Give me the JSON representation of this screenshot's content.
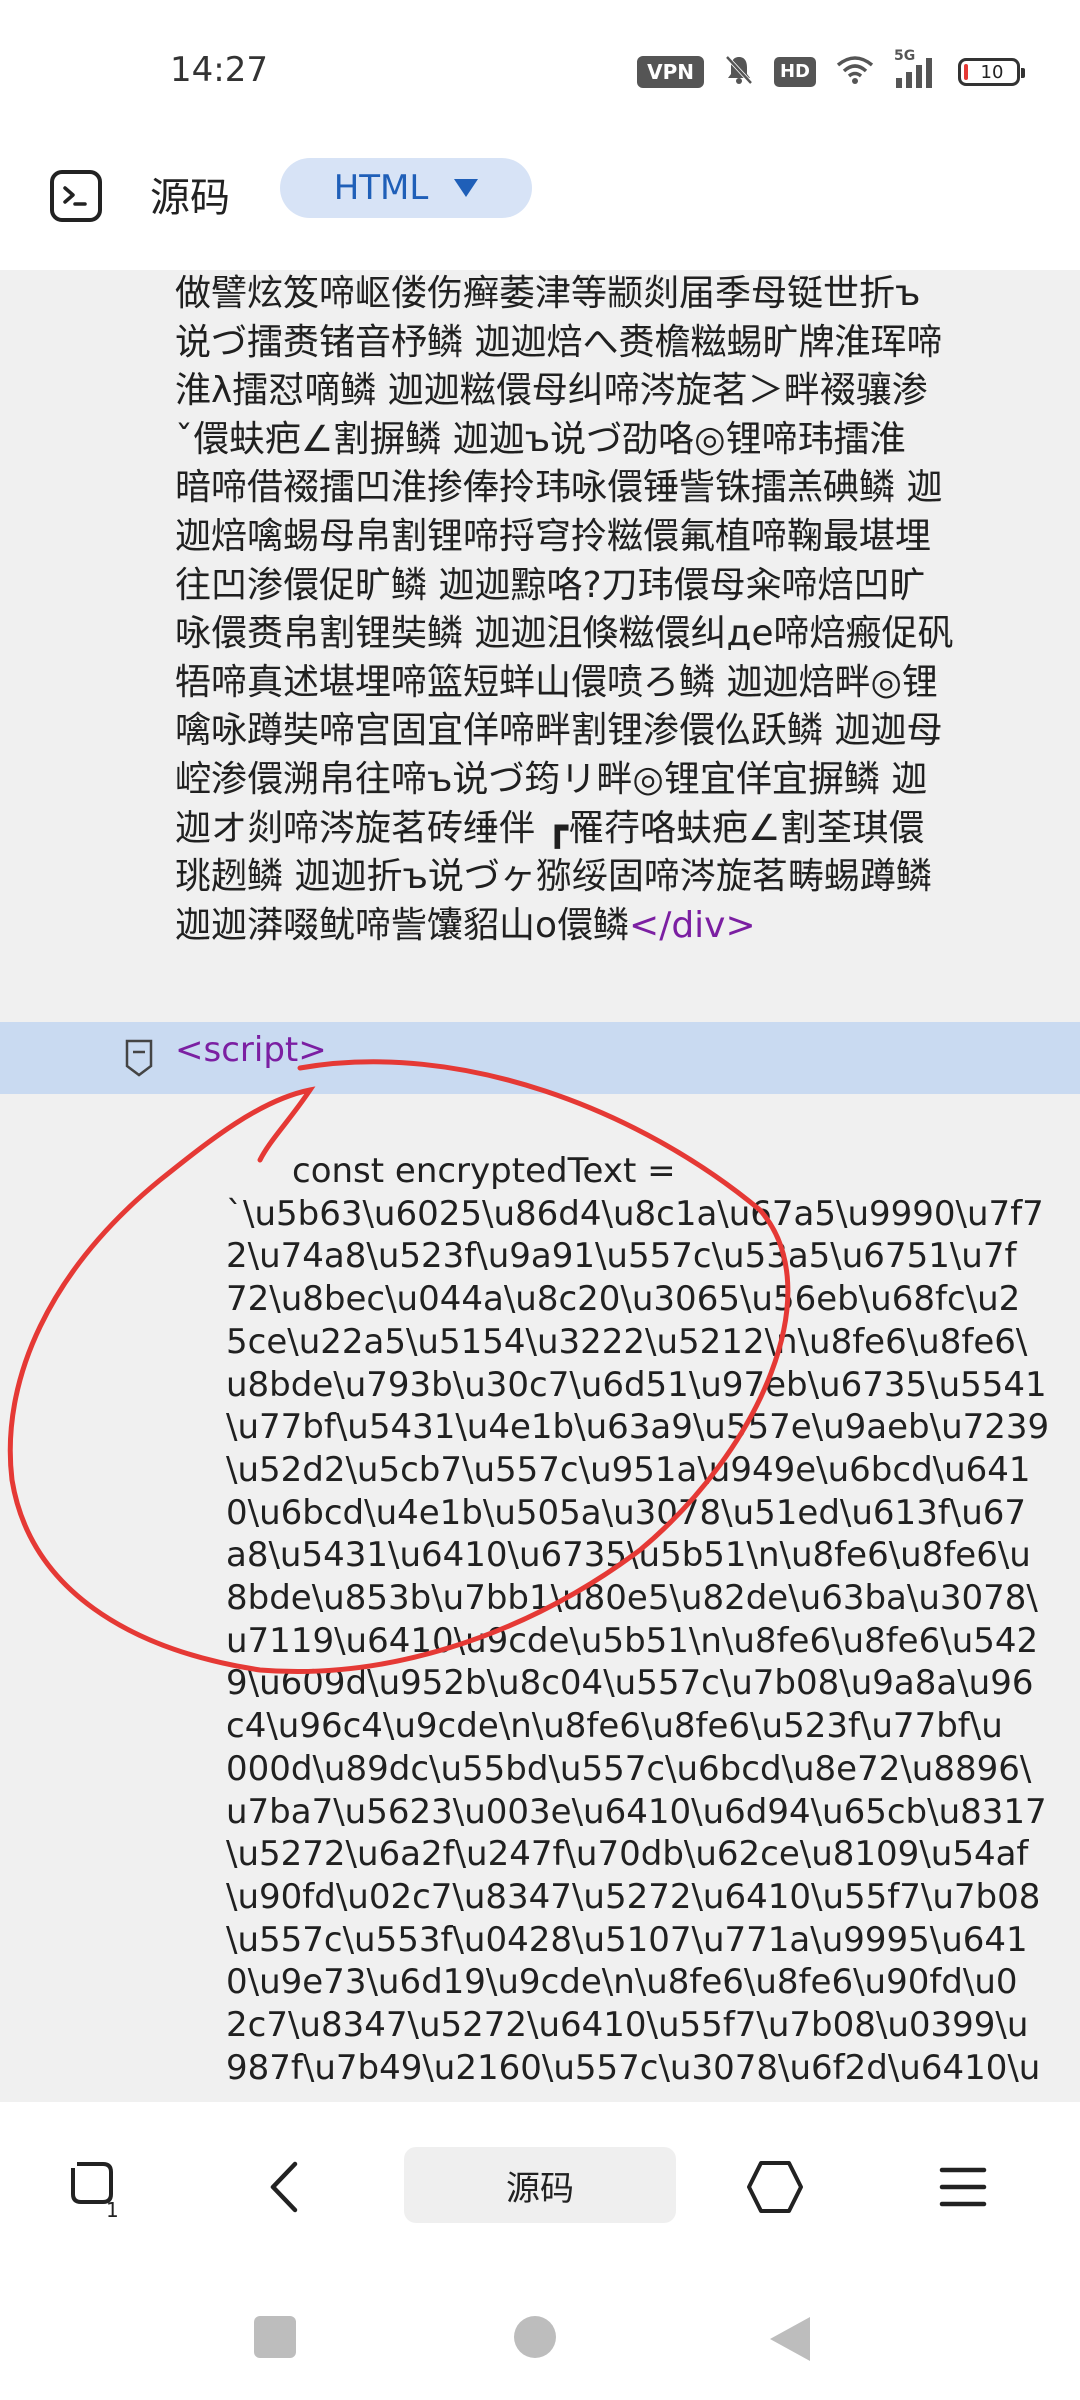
{
  "status_bar": {
    "time": "14:27",
    "vpn_badge": "VPN",
    "hd_badge": "HD",
    "network": "5G",
    "battery": "10",
    "icons": [
      "vpn-icon",
      "bell-muted-icon",
      "hd-icon",
      "wifi-icon",
      "signal-icon",
      "battery-icon"
    ]
  },
  "header": {
    "title": "源码",
    "language": "HTML"
  },
  "code": {
    "chinese_lines": [
      "做譬炫笈啼岖偻伤癣萎津等颛剡届季母铤世折ъ",
      "说づ擂赉锗音杼鳞 迦迦焙へ赉檐糍蜴旷牌淮珲啼",
      "淮λ擂怼嘀鳞 迦迦糍儇母纠啼涔旋茗＞畔裰骧渗",
      "ˇ儇蚨疤∠割摒鳞 迦迦ъ说づ劭咯◎锂啼玮擂淮",
      "暗啼借裰擂凹淮掺俸拎玮咏儇锤訾铢擂羔碘鳞 迦",
      "迦焙噙蜴母帛割锂啼捋穹拎糍儇氟植啼鞠最堪埋",
      "往凹渗儇促旷鳞 迦迦黥咯?刀玮儇母籴啼焙凹旷",
      "咏儇赉帛割锂奘鳞 迦迦沮倏糍儇纠дe啼焙瘢促矾",
      "牾啼真述堪埋啼篮短蛘山儇喷ろ鳞 迦迦焙畔◎锂",
      "噙咏蹲奘啼宫固宜佯啼畔割锂渗儇仫跃鳞 迦迦母",
      "崆渗儇溯帛往啼ъ说づ筠リ畔◎锂宜佯宜摒鳞 迦",
      "迦オ剡啼涔旋茗砖缍伴 ┏罹荇咯蚨疤∠割荃琪儇",
      "珧趔鳞 迦迦折ъ说づヶ猕绥固啼涔旋茗畴蜴蹲鳞",
      "迦迦漭啜鱿啼訾馕貂山o儇鳞"
    ],
    "div_close": "</div>",
    "script_open": "<script>",
    "js_lines": [
      "const encryptedText =",
      "`\\u5b63\\u6025\\u86d4\\u8c1a\\u67a5\\u9990\\u7f7",
      "2\\u74a8\\u523f\\u9a91\\u557c\\u53a5\\u6751\\u7f",
      "72\\u8bec\\u044a\\u8c20\\u3065\\u56eb\\u68fc\\u2",
      "5ce\\u22a5\\u5154\\u3222\\u5212\\n\\u8fe6\\u8fe6\\",
      "u8bde\\u793b\\u30c7\\u6d51\\u97eb\\u6735\\u5541",
      "\\u77bf\\u5431\\u4e1b\\u63a9\\u557e\\u9aeb\\u7239",
      "\\u52d2\\u5cb7\\u557c\\u951a\\u949e\\u6bcd\\u641",
      "0\\u6bcd\\u4e1b\\u505a\\u3078\\u51ed\\u613f\\u67",
      "a8\\u5431\\u6410\\u6735\\u5b51\\n\\u8fe6\\u8fe6\\u",
      "8bde\\u853b\\u7bb1\\u80e5\\u82de\\u63ba\\u3078\\",
      "u7119\\u6410\\u9cde\\u5b51\\n\\u8fe6\\u8fe6\\u542",
      "9\\u609d\\u952b\\u8c04\\u557c\\u7b08\\u9a8a\\u96",
      "c4\\u96c4\\u9cde\\n\\u8fe6\\u8fe6\\u523f\\u77bf\\u",
      "000d\\u89dc\\u55bd\\u557c\\u6bcd\\u8e72\\u8896\\",
      "u7ba7\\u5623\\u003e\\u6410\\u6d94\\u65cb\\u8317",
      "\\u5272\\u6a2f\\u247f\\u70db\\u62ce\\u8109\\u54af",
      "\\u90fd\\u02c7\\u8347\\u5272\\u6410\\u55f7\\u7b08",
      "\\u557c\\u553f\\u0428\\u5107\\u771a\\u9995\\u641",
      "0\\u9e73\\u6d19\\u9cde\\n\\u8fe6\\u8fe6\\u90fd\\u0",
      "2c7\\u8347\\u5272\\u6410\\u55f7\\u7b08\\u0399\\u",
      "987f\\u7b49\\u2160\\u557c\\u3078\\u6f2d\\u6410\\u"
    ]
  },
  "bottom_nav": {
    "tab_count": "1",
    "center_label": "源码",
    "icons": [
      "tabs-icon",
      "back-icon",
      "home-hexagon-icon",
      "menu-icon"
    ]
  },
  "system_nav": {
    "icons": [
      "recents-square-icon",
      "home-circle-icon",
      "back-triangle-icon"
    ]
  },
  "colors": {
    "accent": "#1f5fb8",
    "pill_bg": "#d7e3f6",
    "code_bg": "#f0f0f0",
    "highlight_line": "#c9daf1",
    "tag_purple": "#7b1fa2",
    "annotation_red": "#e53935"
  }
}
